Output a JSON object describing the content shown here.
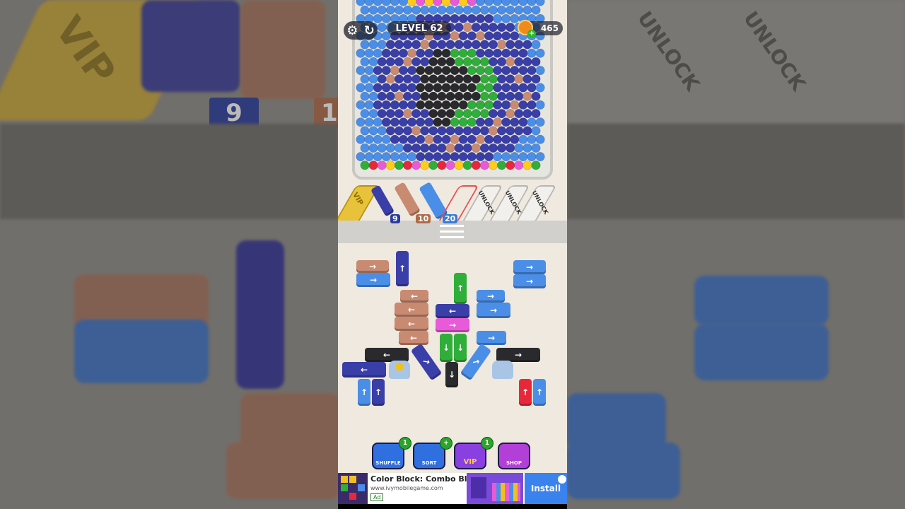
{
  "hud": {
    "level_text": "LEVEL 62",
    "coins": "465",
    "settings_icon": "gear-icon",
    "restart_icon": "restart-icon"
  },
  "slots": {
    "vip_label": "VIP",
    "unlock_label": "UNLOCK",
    "counts": [
      "9",
      "10",
      "20"
    ]
  },
  "background_left": {
    "vip_label": "VIP",
    "count": "9",
    "count_partial": "1"
  },
  "background_right": {
    "unlock_label": "UNLOCK"
  },
  "boosters": [
    {
      "label": "SHUFFLE",
      "badge": "1",
      "color": "#2f6fe0"
    },
    {
      "label": "SORT",
      "badge": "+",
      "color": "#2f6fe0"
    },
    {
      "label": "VIP",
      "badge": "1",
      "color": "#8a3fe0"
    },
    {
      "label": "SHOP",
      "badge": "",
      "color": "#b23fd8"
    }
  ],
  "ad": {
    "title": "Color Block: Combo Blast",
    "url": "www.ivymobilegame.com",
    "tag": "Ad",
    "cta": "Install"
  },
  "colors": {
    "blue": "#4a8ee8",
    "navy": "#3a3ea8",
    "pink": "#c98a72",
    "green": "#2fae3a",
    "black": "#2a2a2e",
    "magenta": "#e85ad8",
    "yellow": "#ffcc1a",
    "red": "#e8283a",
    "tan": "#c98a72"
  }
}
